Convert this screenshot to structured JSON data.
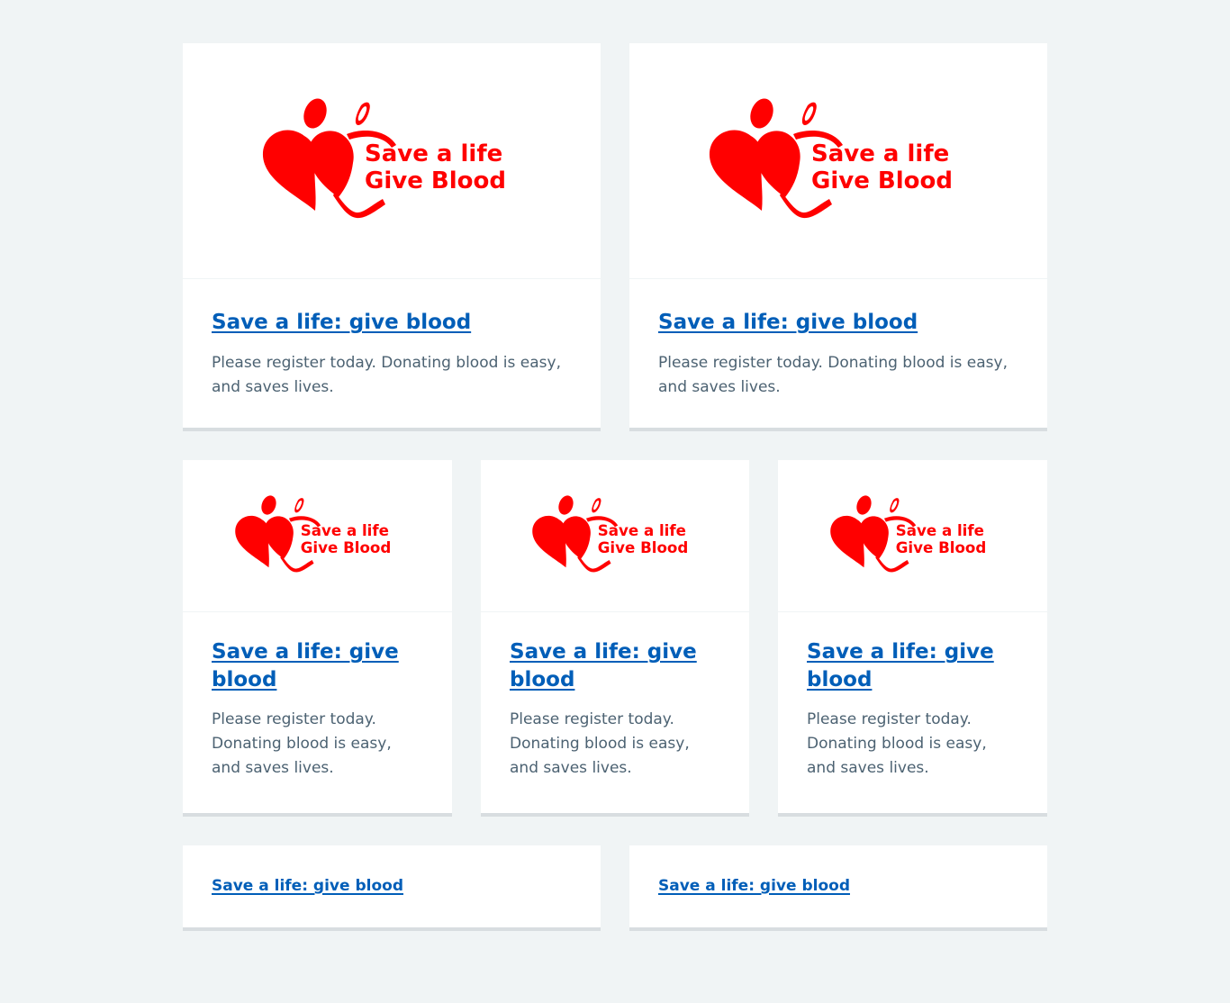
{
  "cards_large": [
    {
      "logo_line1": "Save a life",
      "logo_line2": "Give Blood",
      "title": "Save a life: give blood",
      "description": "Please register today. Donating blood is easy, and saves lives."
    },
    {
      "logo_line1": "Save a life",
      "logo_line2": "Give Blood",
      "title": "Save a life: give blood",
      "description": "Please register today. Donating blood is easy, and saves lives."
    }
  ],
  "cards_medium": [
    {
      "logo_line1": "Save a life",
      "logo_line2": "Give Blood",
      "title": "Save a life: give blood",
      "description": "Please register today. Donating blood is easy, and saves lives."
    },
    {
      "logo_line1": "Save a life",
      "logo_line2": "Give Blood",
      "title": "Save a life: give blood",
      "description": "Please register today. Donating blood is easy, and saves lives."
    },
    {
      "logo_line1": "Save a life",
      "logo_line2": "Give Blood",
      "title": "Save a life: give blood",
      "description": "Please register today. Donating blood is easy, and saves lives."
    }
  ],
  "cards_small": [
    {
      "title": "Save a life: give blood"
    },
    {
      "title": "Save a life: give blood"
    }
  ],
  "colors": {
    "background": "#f0f4f5",
    "card": "#ffffff",
    "link": "#005eb8",
    "text": "#4c6272",
    "logo_red": "#ff0000",
    "card_border": "#d8dde0"
  },
  "icons": {
    "logo": "give-blood-hearts-logo"
  }
}
